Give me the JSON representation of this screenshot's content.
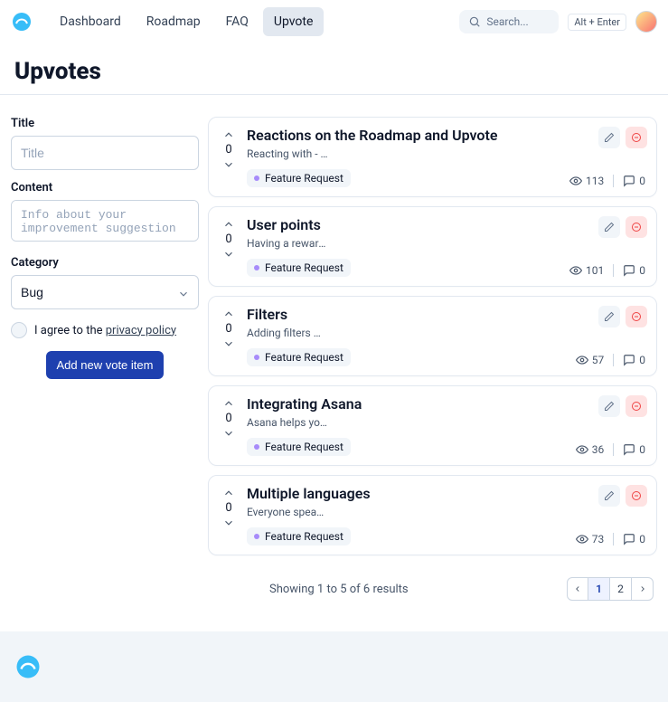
{
  "header": {
    "nav": [
      {
        "label": "Dashboard"
      },
      {
        "label": "Roadmap"
      },
      {
        "label": "FAQ"
      },
      {
        "label": "Upvote"
      }
    ],
    "active_index": 3,
    "search": {
      "placeholder": "Search...",
      "kbd_hint": "Alt + Enter"
    }
  },
  "page": {
    "title": "Upvotes"
  },
  "form": {
    "title_label": "Title",
    "title_placeholder": "Title",
    "content_label": "Content",
    "content_placeholder": "Info about your improvement suggestion",
    "category_label": "Category",
    "category_value": "Bug",
    "agree_prefix": "I agree to the ",
    "agree_link": "privacy policy",
    "submit_label": "Add new vote item"
  },
  "items": [
    {
      "title": "Reactions on the Roadmap and Upvote",
      "desc": "Reacting with - likes, di...",
      "tag": "Feature Request",
      "views": 113,
      "comments": 0,
      "votes": 0
    },
    {
      "title": "User points",
      "desc": "Having a reward system fo...",
      "tag": "Feature Request",
      "views": 101,
      "comments": 0,
      "votes": 0
    },
    {
      "title": "Filters",
      "desc": "Adding filters will help...",
      "tag": "Feature Request",
      "views": 57,
      "comments": 0,
      "votes": 0
    },
    {
      "title": "Integrating Asana",
      "desc": "Asana helps you organize...",
      "tag": "Feature Request",
      "views": 36,
      "comments": 0,
      "votes": 0
    },
    {
      "title": "Multiple languages",
      "desc": "Everyone speaks a differe...",
      "tag": "Feature Request",
      "views": 73,
      "comments": 0,
      "votes": 0
    }
  ],
  "pagination": {
    "info_text": "Showing 1 to 5 of 6 results",
    "pages": [
      1,
      2
    ],
    "active_page": 1
  }
}
